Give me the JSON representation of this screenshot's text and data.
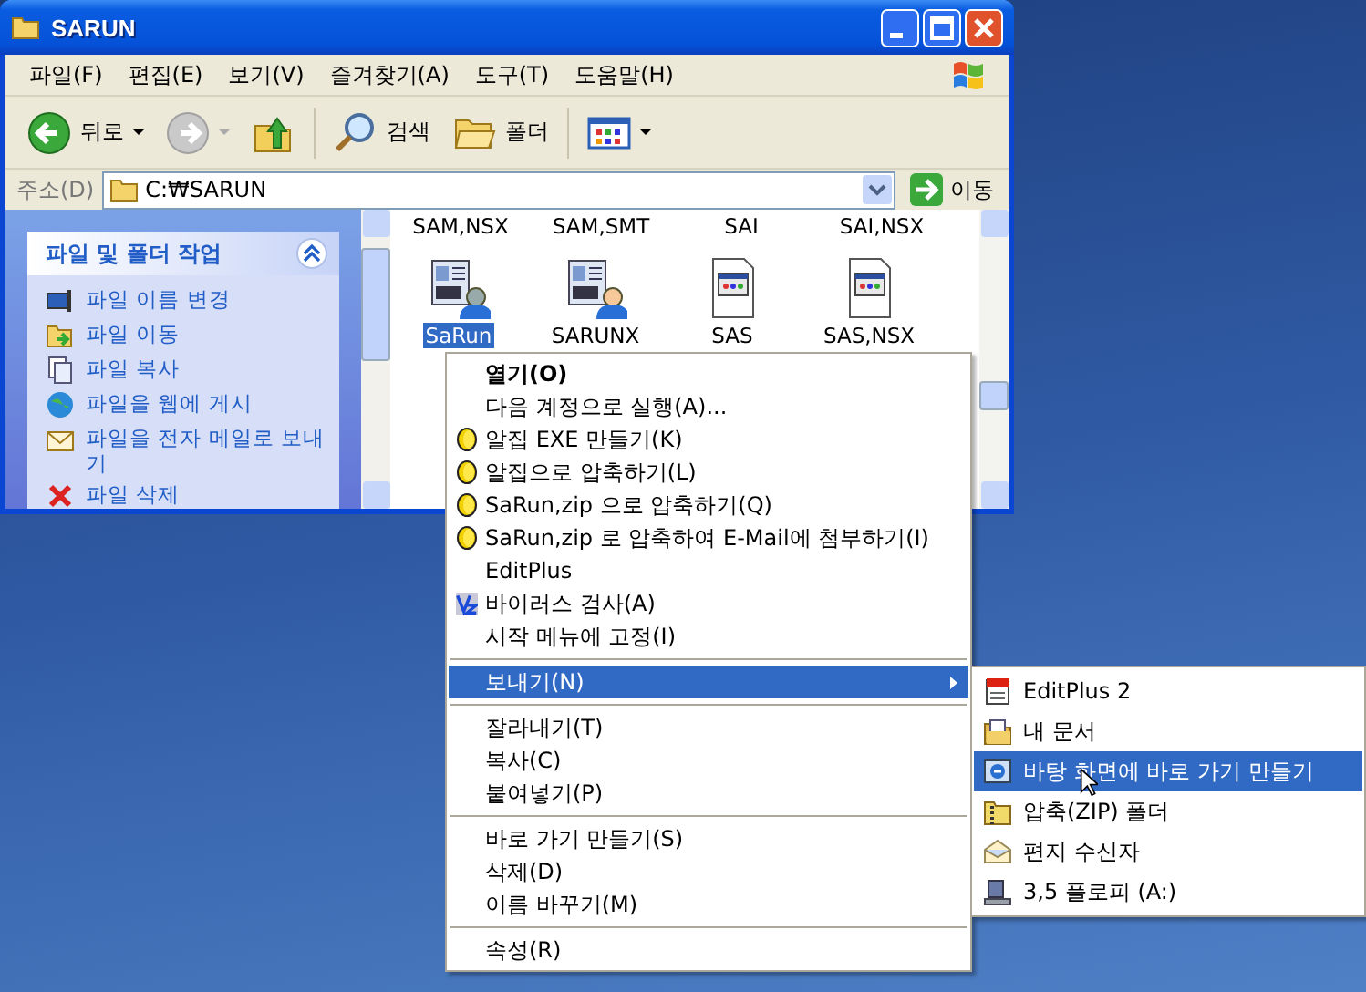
{
  "window": {
    "title": "SARUN"
  },
  "menu_bar": [
    "파일(F)",
    "편집(E)",
    "보기(V)",
    "즐겨찾기(A)",
    "도구(T)",
    "도움말(H)"
  ],
  "toolbar": [
    {
      "kind": "back",
      "label": "뒤로",
      "disabled": false
    },
    {
      "kind": "forward",
      "disabled": true
    },
    {
      "kind": "up"
    },
    {
      "kind": "search",
      "label": "검색"
    },
    {
      "kind": "folders",
      "label": "폴더"
    },
    {
      "kind": "views"
    }
  ],
  "address": {
    "label": "주소(D)",
    "value": "C:₩SARUN",
    "go": "이동"
  },
  "task_panel": {
    "title": "파일 및 폴더 작업",
    "expanded": true,
    "items": [
      "파일 이름 변경",
      "파일 이동",
      "파일 복사",
      "파일을 웹에 게시",
      "파일을 전자 메일로 보내기",
      "파일 삭제"
    ]
  },
  "files_top_row": [
    "SAM,NSX",
    "SAM,SMT",
    "SAI",
    "SAI,NSX"
  ],
  "files": [
    {
      "name": "SaRun",
      "kind": "app",
      "selected": true
    },
    {
      "name": "SARUNX",
      "kind": "app",
      "selected": false
    },
    {
      "name": "SAS",
      "kind": "doc",
      "selected": false
    },
    {
      "name": "SAS,NSX",
      "kind": "doc",
      "selected": false
    }
  ],
  "context_menu": [
    {
      "kind": "default",
      "label": "열기(O)",
      "selected": false
    },
    {
      "kind": "command",
      "label": "다음 계정으로 실행(A)...",
      "selected": false
    },
    {
      "kind": "zip-command",
      "label": "알집 EXE 만들기(K)",
      "selected": false
    },
    {
      "kind": "zip-command",
      "label": "알집으로 압축하기(L)",
      "selected": false
    },
    {
      "kind": "zip-command",
      "label": "SaRun,zip 으로 압축하기(Q)",
      "selected": false
    },
    {
      "kind": "zip-command",
      "label": "SaRun,zip 로 압축하여 E-Mail에 첨부하기(I)",
      "selected": false
    },
    {
      "kind": "command",
      "label": "EditPlus",
      "selected": false
    },
    {
      "kind": "scan-command",
      "label": "바이러스 검사(A)",
      "selected": false
    },
    {
      "kind": "command",
      "label": "시작 메뉴에 고정(I)",
      "selected": false
    },
    {
      "kind": "separator"
    },
    {
      "kind": "submenu",
      "label": "보내기(N)",
      "selected": true
    },
    {
      "kind": "separator"
    },
    {
      "kind": "command",
      "label": "잘라내기(T)",
      "selected": false
    },
    {
      "kind": "command",
      "label": "복사(C)",
      "selected": false
    },
    {
      "kind": "command",
      "label": "붙여넣기(P)",
      "selected": false
    },
    {
      "kind": "separator"
    },
    {
      "kind": "command",
      "label": "바로 가기 만들기(S)",
      "selected": false
    },
    {
      "kind": "command",
      "label": "삭제(D)",
      "selected": false
    },
    {
      "kind": "command",
      "label": "이름 바꾸기(M)",
      "selected": false
    },
    {
      "kind": "separator"
    },
    {
      "kind": "command",
      "label": "속성(R)",
      "selected": false
    }
  ],
  "submenu": [
    {
      "label": "EditPlus 2",
      "selected": false
    },
    {
      "label": "내 문서",
      "selected": false
    },
    {
      "label": "바탕 화면에 바로 가기 만들기",
      "selected": true
    },
    {
      "label": "압축(ZIP) 폴더",
      "selected": false
    },
    {
      "label": "편지 수신자",
      "selected": false
    },
    {
      "label": "3,5 플로피 (A:)",
      "selected": false
    }
  ]
}
